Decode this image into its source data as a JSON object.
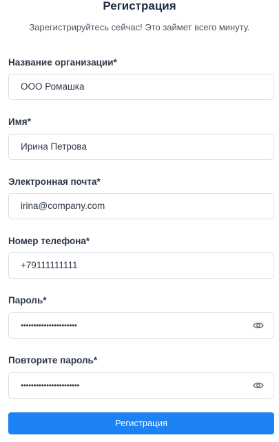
{
  "header": {
    "title": "Регистрация",
    "subtitle": "Зарегистрируйтесь сейчас! Это займет всего минуту."
  },
  "fields": {
    "organization": {
      "label": "Название организации*",
      "value": "ООО Ромашка"
    },
    "name": {
      "label": "Имя*",
      "value": "Ирина Петрова"
    },
    "email": {
      "label": "Электронная почта*",
      "value": "irina@company.com"
    },
    "phone": {
      "label": "Номер телефона*",
      "value": "+79111111111"
    },
    "password": {
      "label": "Пароль*",
      "value": "••••••••••••••••••••••",
      "toggle_icon": "eye-icon"
    },
    "password_confirm": {
      "label": "Повторите пароль*",
      "value": "•••••••••••••••••••••••",
      "toggle_icon": "eye-icon"
    }
  },
  "submit": {
    "label": "Регистрация"
  },
  "colors": {
    "accent": "#1d82f4",
    "border": "#d9dee5",
    "title": "#1f2a44",
    "icon": "#6b7480"
  }
}
